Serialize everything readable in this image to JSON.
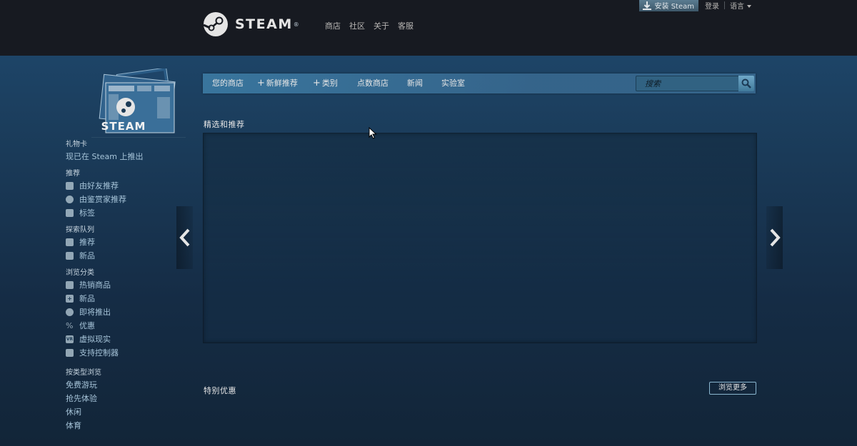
{
  "header": {
    "logo_text": "STEAM",
    "logo_reg": "®",
    "nav": [
      "商店",
      "社区",
      "关于",
      "客服"
    ],
    "install_label": "安装 Steam",
    "login_label": "登录",
    "language_label": "语言"
  },
  "store_nav": {
    "tabs": [
      {
        "label": "您的商店",
        "plus": false
      },
      {
        "label": "新鲜推荐",
        "plus": true
      },
      {
        "label": "类别",
        "plus": true
      },
      {
        "label": "点数商店",
        "plus": false
      },
      {
        "label": "新闻",
        "plus": false
      },
      {
        "label": "实验室",
        "plus": false
      }
    ],
    "search_placeholder": "搜索"
  },
  "left_col": {
    "giftcard_text": "STEAM",
    "giftcard_heading": "礼物卡",
    "giftcard_link": "现已在 Steam 上推出",
    "recommend_heading": "推荐",
    "recommend_items": [
      {
        "label": "由好友推荐",
        "icon": "friends-icon"
      },
      {
        "label": "由鉴赏家推荐",
        "icon": "curator-icon"
      },
      {
        "label": "标签",
        "icon": "tags-icon"
      }
    ],
    "queue_heading": "探索队列",
    "queue_items": [
      {
        "label": "推荐",
        "icon": "queue-recommend-icon"
      },
      {
        "label": "新品",
        "icon": "queue-new-icon"
      }
    ],
    "browse_heading": "浏览分类",
    "browse_items": [
      {
        "label": "热销商品",
        "icon": "chart-icon"
      },
      {
        "label": "新品",
        "icon": "plus-icon"
      },
      {
        "label": "即将推出",
        "icon": "clock-icon"
      },
      {
        "label": "优惠",
        "icon": "percent-icon"
      },
      {
        "label": "虚拟现实",
        "icon": "vr-icon"
      },
      {
        "label": "支持控制器",
        "icon": "gamepad-icon"
      }
    ],
    "type_heading": "按类型浏览",
    "type_items": [
      "免费游玩",
      "抢先体验",
      "休闲",
      "体育"
    ]
  },
  "main": {
    "featured_title": "精选和推荐",
    "specials_title": "特别优惠",
    "browse_more_label": "浏览更多"
  },
  "colors": {
    "header_bg": "#171a21",
    "page_bg": "#1b3d5c",
    "nav_bar": "#3e7ea7",
    "link": "#a6c4d9"
  }
}
